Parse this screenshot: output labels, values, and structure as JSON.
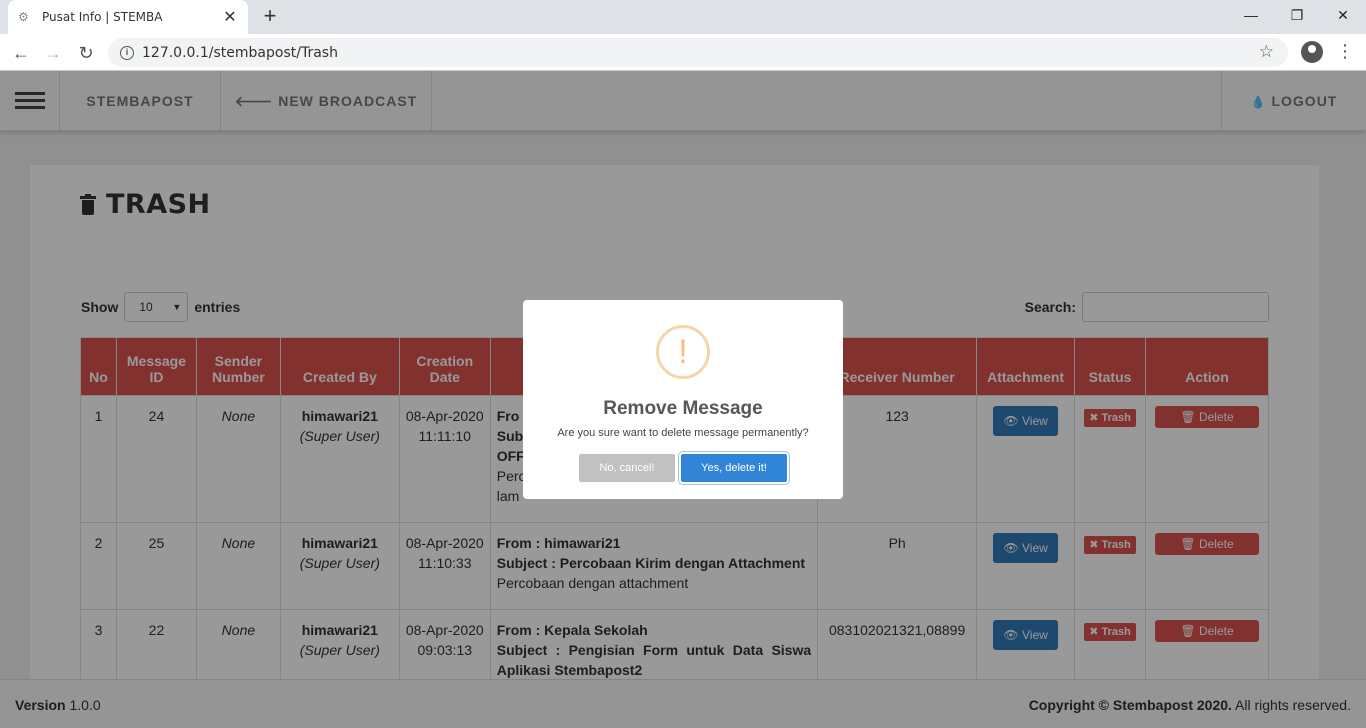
{
  "browser": {
    "tab_title": "Pusat Info | STEMBA",
    "tab_close": "✕",
    "new_tab": "+",
    "url": "127.0.0.1/stembapost/Trash",
    "win_min": "—",
    "win_max": "❐",
    "win_close": "✕"
  },
  "nav": {
    "brand": "STEMBAPOST",
    "new_broadcast": "NEW BROADCAST",
    "logout": "LOGOUT"
  },
  "page": {
    "title": "TRASH",
    "show_label": "Show",
    "entries_value": "10",
    "entries_label": "entries",
    "search_label": "Search:"
  },
  "table": {
    "headers": {
      "no": "No",
      "message_id": "Message ID",
      "sender_number": "Sender Number",
      "created_by": "Created By",
      "creation_date": "Creation Date",
      "receiver_number": "Receiver Number",
      "attachment": "Attachment",
      "status": "Status",
      "action": "Action"
    },
    "rows": [
      {
        "no": "1",
        "message_id": "24",
        "sender": "None",
        "created_by": "himawari21",
        "role": "(Super User)",
        "date": "08-Apr-2020",
        "time": "11:11:10",
        "msg_line1": "Fro",
        "msg_line2": "Sub",
        "msg_line3": "OFF",
        "msg_line4": "Perc",
        "msg_line5": "lam",
        "receiver": "123"
      },
      {
        "no": "2",
        "message_id": "25",
        "sender": "None",
        "created_by": "himawari21",
        "role": "(Super User)",
        "date": "08-Apr-2020",
        "time": "11:10:33",
        "msg_line1": "From : himawari21",
        "msg_line2": "Subject : Percobaan Kirim dengan Attachment",
        "msg_line3": "Percobaan dengan attachment",
        "receiver": "Ph"
      },
      {
        "no": "3",
        "message_id": "22",
        "sender": "None",
        "created_by": "himawari21",
        "role": "(Super User)",
        "date": "08-Apr-2020",
        "time": "09:03:13",
        "msg_line1": "From : Kepala Sekolah",
        "msg_line2": "Subject : Pengisian Form untuk Data Siswa Aplikasi Stembapost2",
        "receiver": "083102021321,08899"
      }
    ],
    "view_label": "View",
    "trash_label": "Trash",
    "delete_label": "Delete"
  },
  "footer": {
    "version_label": "Version",
    "version_value": "1.0.0",
    "copyright_bold": "Copyright © Stembapost 2020.",
    "copyright_rest": " All rights reserved."
  },
  "modal": {
    "icon": "!",
    "title": "Remove Message",
    "text": "Are you sure want to delete message permanently?",
    "cancel": "No, cancel!",
    "confirm": "Yes, delete it!"
  }
}
